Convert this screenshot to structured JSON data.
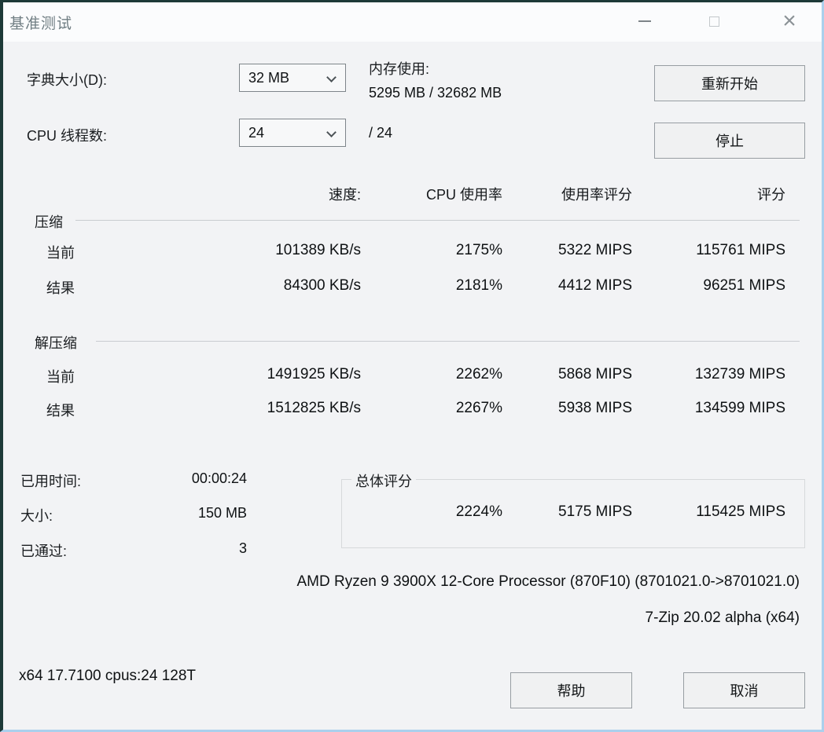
{
  "window": {
    "title": "基准测试"
  },
  "icons": {
    "close": "×"
  },
  "settings": {
    "dictionary_label": "字典大小(D):",
    "dictionary_value": "32 MB",
    "threads_label": "CPU 线程数:",
    "threads_value": "24",
    "threads_total": "/ 24",
    "memory_label": "内存使用:",
    "memory_value": "5295 MB / 32682 MB"
  },
  "actions": {
    "restart": "重新开始",
    "stop": "停止",
    "help": "帮助",
    "cancel": "取消"
  },
  "table": {
    "headers": {
      "speed": "速度:",
      "cpu_usage": "CPU 使用率",
      "usage_rating": "使用率评分",
      "rating": "评分"
    },
    "groups": [
      {
        "name": "压缩",
        "rows": [
          {
            "label": "当前",
            "speed": "101389 KB/s",
            "cpu_usage": "2175%",
            "usage_rating": "5322 MIPS",
            "rating": "115761 MIPS"
          },
          {
            "label": "结果",
            "speed": "84300 KB/s",
            "cpu_usage": "2181%",
            "usage_rating": "4412 MIPS",
            "rating": "96251 MIPS"
          }
        ]
      },
      {
        "name": "解压缩",
        "rows": [
          {
            "label": "当前",
            "speed": "1491925 KB/s",
            "cpu_usage": "2262%",
            "usage_rating": "5868 MIPS",
            "rating": "132739 MIPS"
          },
          {
            "label": "结果",
            "speed": "1512825 KB/s",
            "cpu_usage": "2267%",
            "usage_rating": "5938 MIPS",
            "rating": "134599 MIPS"
          }
        ]
      }
    ]
  },
  "status": {
    "elapsed_label": "已用时间:",
    "elapsed_value": "00:00:24",
    "size_label": "大小:",
    "size_value": "150 MB",
    "passes_label": "已通过:",
    "passes_value": "3"
  },
  "total": {
    "label": "总体评分",
    "cpu_usage": "2224%",
    "usage_rating": "5175 MIPS",
    "rating": "115425 MIPS"
  },
  "footer": {
    "cpu_info": "AMD Ryzen 9 3900X 12-Core Processor (870F10) (8701021.0->8701021.0)",
    "version": "7-Zip 20.02 alpha (x64)",
    "build_info": "x64 17.7100 cpus:24 128T"
  }
}
